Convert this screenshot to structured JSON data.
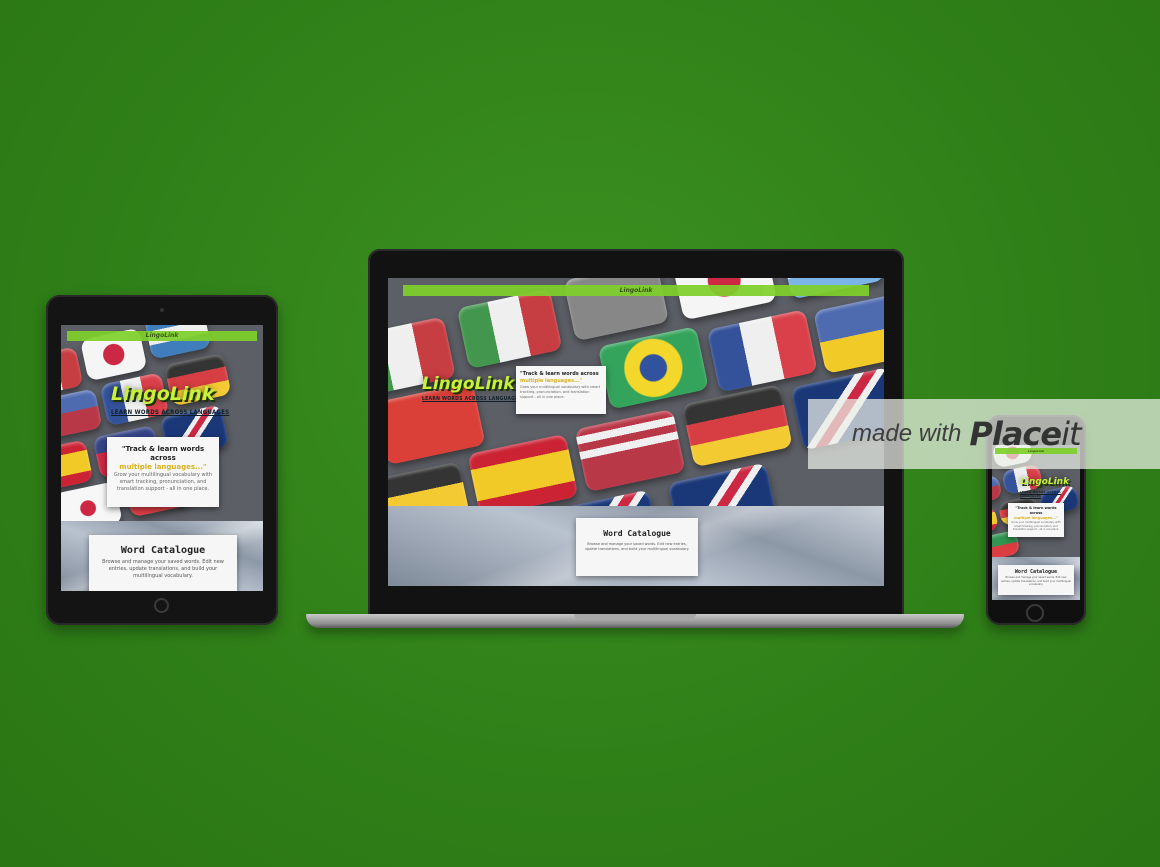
{
  "site": {
    "nav_title": "LingoLink",
    "logo": "LingoLink",
    "tagline": "LEARN WORDS ACROSS LANGUAGES",
    "quote_line1": "\"Track & learn words across",
    "quote_line2": "multiple languages...\"",
    "quote_line3": "Grow your multilingual vocabulary with smart tracking, pronunciation, and translation support - all in one place.",
    "card_title": "Word Catalogue",
    "card_desc": "Browse and manage your saved words. Edit new entries, update translations, and build your multilingual vocabulary."
  },
  "watermark": {
    "made_with": "made with",
    "brand": "Place",
    "brand_suffix": "it"
  },
  "colors": {
    "background": "#358a1c",
    "accent_green": "#7fd02a",
    "logo_yellow": "#c7f13b",
    "quote_gold": "#d8b21f"
  },
  "devices": [
    "tablet",
    "laptop",
    "phone"
  ]
}
